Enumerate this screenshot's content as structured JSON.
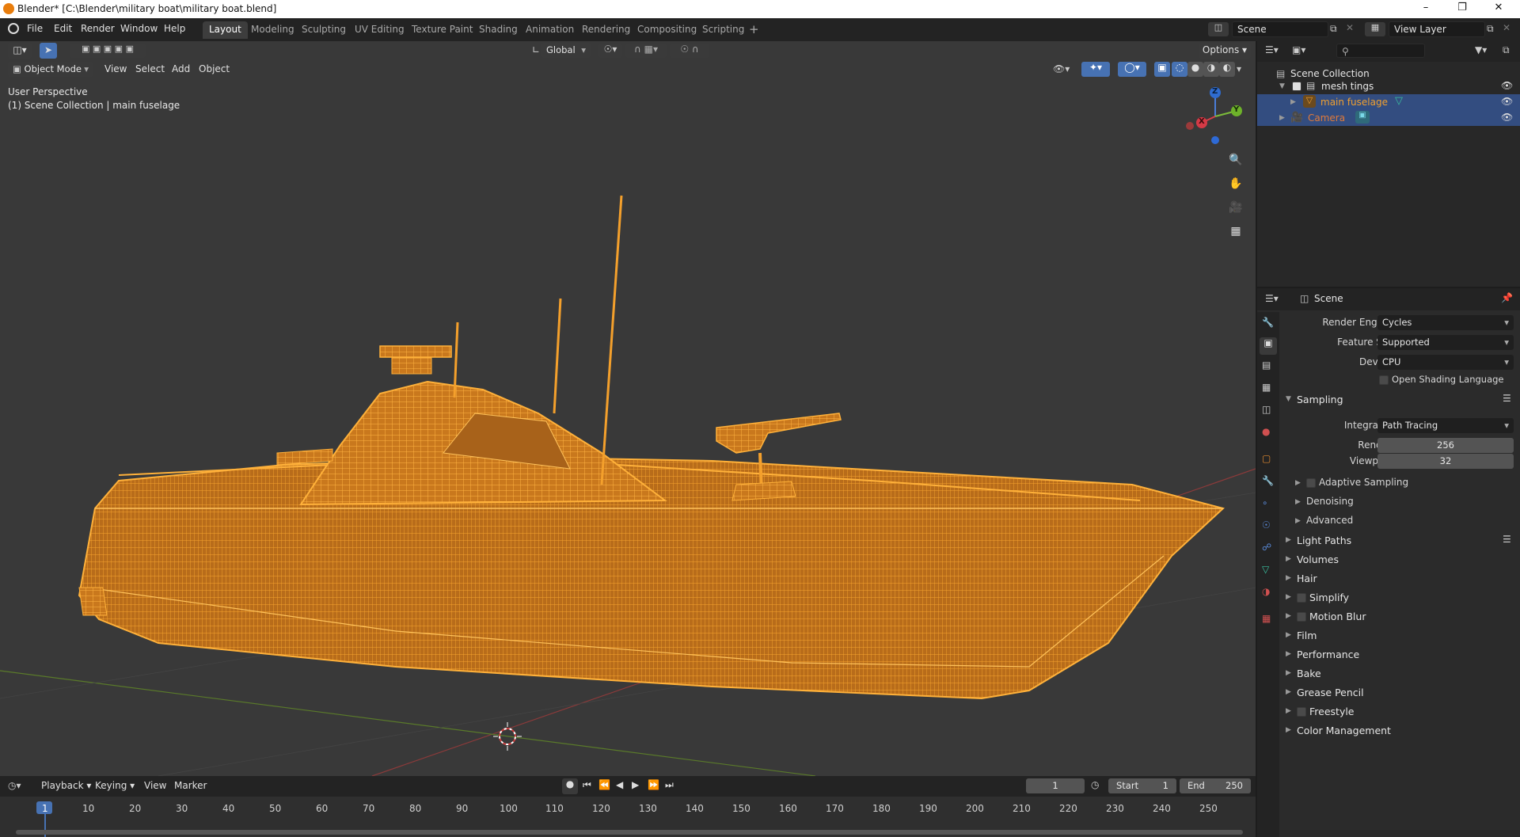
{
  "window": {
    "title": "Blender* [C:\\Blender\\military boat\\military boat.blend]"
  },
  "menu": [
    "File",
    "Edit",
    "Render",
    "Window",
    "Help"
  ],
  "workspaces": [
    "Layout",
    "Modeling",
    "Sculpting",
    "UV Editing",
    "Texture Paint",
    "Shading",
    "Animation",
    "Rendering",
    "Compositing",
    "Scripting"
  ],
  "scene_field": "Scene",
  "view_layer_field": "View Layer",
  "toolbar": {
    "transform_orientation": "Global",
    "options": "Options"
  },
  "viewport": {
    "mode": "Object Mode",
    "header_menus": [
      "View",
      "Select",
      "Add",
      "Object"
    ],
    "perspective_label": "User Perspective",
    "collection_label": "(1) Scene Collection | main fuselage",
    "gizmo": {
      "x": "X",
      "y": "Y",
      "z": "Z"
    }
  },
  "outliner": {
    "root": "Scene Collection",
    "items": [
      {
        "label": "mesh tings",
        "type": "collection",
        "color": "#e0e0e0"
      },
      {
        "label": "main fuselage",
        "type": "mesh",
        "color": "#f0a030",
        "selected": true
      },
      {
        "label": "Camera",
        "type": "camera",
        "color": "#e07a3a",
        "selected": true
      }
    ]
  },
  "properties": {
    "context": "Scene",
    "render_engine_label": "Render Engine",
    "render_engine": "Cycles",
    "feature_set_label": "Feature Set",
    "feature_set": "Supported",
    "device_label": "Device",
    "device": "CPU",
    "osl_label": "Open Shading Language",
    "sampling": {
      "header": "Sampling",
      "integrator_label": "Integrator",
      "integrator": "Path Tracing",
      "render_label": "Render",
      "render": "256",
      "viewport_label": "Viewport",
      "viewport": "32",
      "sub": [
        "Adaptive Sampling",
        "Denoising",
        "Advanced"
      ]
    },
    "panels": [
      "Light Paths",
      "Volumes",
      "Hair",
      "Simplify",
      "Motion Blur",
      "Film",
      "Performance",
      "Bake",
      "Grease Pencil",
      "Freestyle",
      "Color Management"
    ]
  },
  "timeline": {
    "menus": [
      "Playback",
      "Keying",
      "View",
      "Marker"
    ],
    "current_frame": "1",
    "start_label": "Start",
    "start": "1",
    "end_label": "End",
    "end": "250",
    "ticks": [
      "1",
      "10",
      "20",
      "30",
      "40",
      "50",
      "60",
      "70",
      "80",
      "90",
      "100",
      "110",
      "120",
      "130",
      "140",
      "150",
      "160",
      "170",
      "180",
      "190",
      "200",
      "210",
      "220",
      "230",
      "240",
      "250"
    ]
  },
  "colors": {
    "accent": "#4772b3",
    "wireframe": "#f2a02a",
    "selected_row": "#334d80"
  }
}
